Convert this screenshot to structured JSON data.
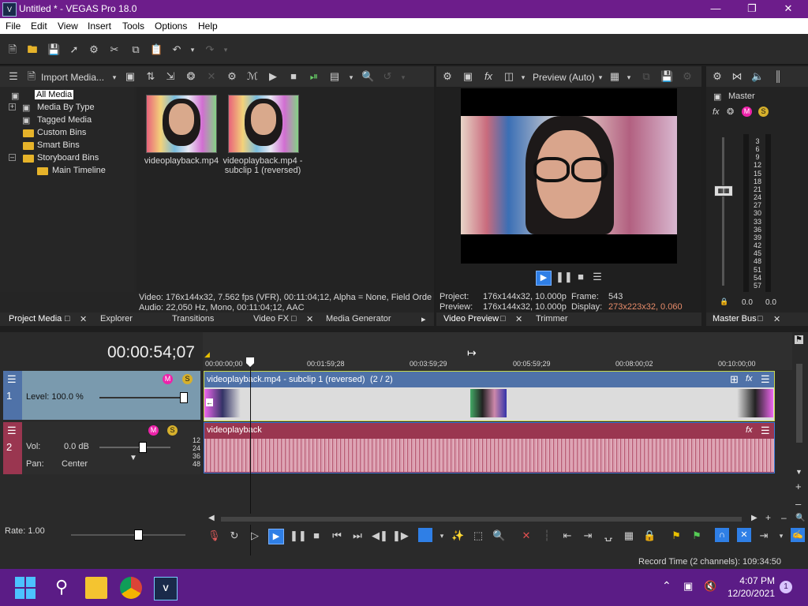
{
  "window": {
    "title": "Untitled * - VEGAS Pro 18.0",
    "app_badge": "V"
  },
  "menu": [
    "File",
    "Edit",
    "View",
    "Insert",
    "Tools",
    "Options",
    "Help"
  ],
  "project_media": {
    "import_label": "Import Media...",
    "tree": [
      "All Media",
      "Media By Type",
      "Tagged Media",
      "Custom Bins",
      "Smart Bins",
      "Storyboard Bins",
      "Main Timeline"
    ],
    "thumbs": [
      {
        "label": "videoplayback.mp4"
      },
      {
        "label": "videoplayback.mp4 - subclip 1 (reversed)"
      }
    ],
    "info_video": "Video: 176x144x32, 7.562 fps (VFR), 00:11:04;12, Alpha = None, Field Orde",
    "info_audio": "Audio: 22,050 Hz, Mono, 00:11:04;12, AAC",
    "tabs": [
      "Project Media",
      "Explorer",
      "Transitions",
      "Video FX",
      "Media Generator"
    ]
  },
  "preview": {
    "mode": "Preview (Auto)",
    "project_label": "Project:",
    "project_value": "176x144x32, 10.000p",
    "preview_label": "Preview:",
    "preview_value": "176x144x32, 10.000p",
    "frame_label": "Frame:",
    "frame_value": "543",
    "display_label": "Display:",
    "display_value": "273x223x32, 0.060",
    "tabs": [
      "Video Preview",
      "Trimmer"
    ]
  },
  "master": {
    "label": "Master",
    "scale": [
      "3",
      "6",
      "9",
      "12",
      "15",
      "18",
      "21",
      "24",
      "27",
      "30",
      "33",
      "36",
      "39",
      "42",
      "45",
      "48",
      "51",
      "54",
      "57"
    ],
    "left_value": "0.0",
    "right_value": "0.0",
    "tab": "Master Bus"
  },
  "timeline": {
    "timecode": "00:00:54;07",
    "ruler": [
      "00:00:00;00",
      "00:01:59;28",
      "00:03:59;29",
      "00:05:59;29",
      "00:08:00;02",
      "00:10:00;00"
    ],
    "video_track": {
      "number": "1",
      "level_label": "Level: 100.0 %",
      "clip_title": "videoplayback.mp4 - subclip 1 (reversed)",
      "clip_count": "(2 / 2)"
    },
    "audio_track": {
      "number": "2",
      "vol_label": "Vol:",
      "vol_value": "0.0 dB",
      "pan_label": "Pan:",
      "pan_value": "Center",
      "clip_title": "videoplayback",
      "db_marks": [
        "12",
        "24",
        "36",
        "48"
      ]
    },
    "rate": "Rate: 1.00"
  },
  "status": {
    "record_time": "Record Time (2 channels): 109:34:50"
  },
  "taskbar": {
    "time": "4:07 PM",
    "date": "12/20/2021",
    "notification_count": "1"
  }
}
